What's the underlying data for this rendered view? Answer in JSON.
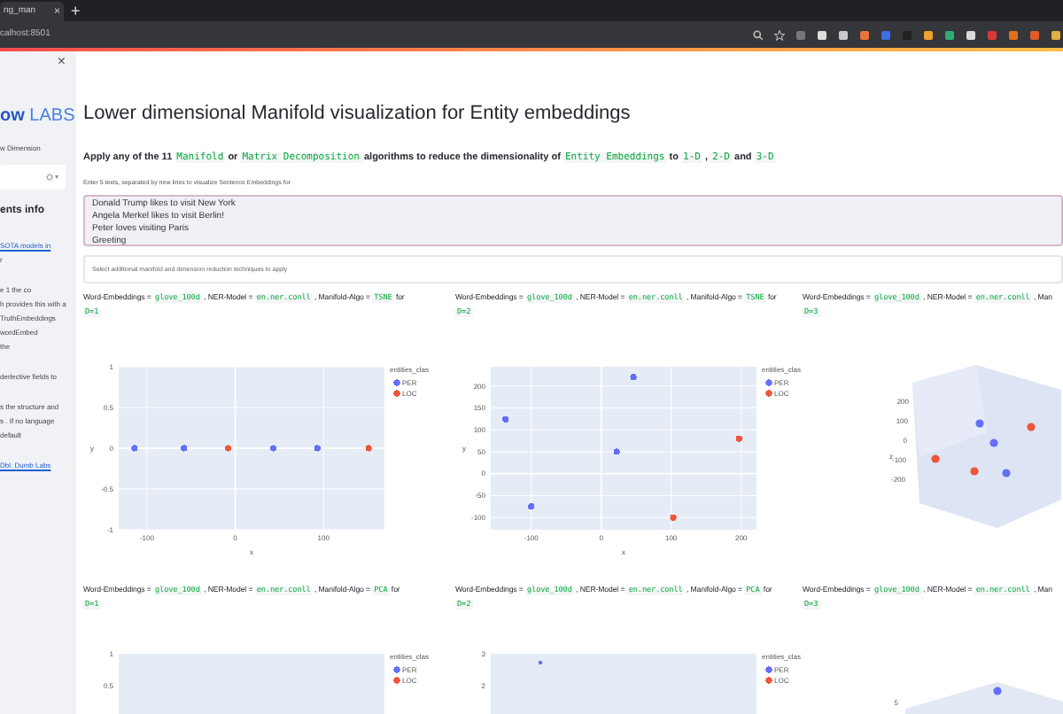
{
  "browser": {
    "tab": {
      "title": "ng_man",
      "close": "×"
    },
    "new_tab": "+",
    "address": "calhost:8501"
  },
  "sidebar": {
    "close": "×",
    "logo": {
      "part_1": "ow",
      "part_2": "LABS"
    },
    "subtitle": "w Dimension",
    "select": {
      "caret": "▾"
    },
    "heading": "ents info",
    "groups": [
      [
        {
          "kind": "link",
          "text": "SOTA models in"
        },
        {
          "kind": "text",
          "text": "r"
        }
      ],
      [
        {
          "kind": "text",
          "text": "e 1 the co"
        },
        {
          "kind": "text",
          "text": "h provides this with a"
        },
        {
          "kind": "text",
          "text": "TruthEmbeddings"
        },
        {
          "kind": "text",
          "text": "wordEmbed"
        },
        {
          "kind": "text",
          "text": "the"
        }
      ],
      [
        {
          "kind": "text",
          "text": "derlective fields to"
        }
      ],
      [
        {
          "kind": "text",
          "text": "s the structure and"
        },
        {
          "kind": "text",
          "text": "s . If no language"
        },
        {
          "kind": "text",
          "text": "default"
        }
      ],
      [
        {
          "kind": "link",
          "text": "Dbl. Dumb Labs"
        }
      ]
    ]
  },
  "main": {
    "title": "Lower dimensional Manifold visualization for Entity embeddings",
    "intro": [
      {
        "kind": "text",
        "text": "Apply any of the 11"
      },
      {
        "kind": "code",
        "text": "Manifold"
      },
      {
        "kind": "text",
        "text": "or"
      },
      {
        "kind": "code",
        "text": "Matrix Decomposition"
      },
      {
        "kind": "text",
        "text": "algorithms to reduce the dimensionality of"
      },
      {
        "kind": "code",
        "text": "Entity Embeddings"
      },
      {
        "kind": "text",
        "text": "to"
      },
      {
        "kind": "code",
        "text": "1-D"
      },
      {
        "kind": "text",
        "text": ","
      },
      {
        "kind": "code",
        "text": "2-D"
      },
      {
        "kind": "text",
        "text": "and"
      },
      {
        "kind": "code",
        "text": "3-D"
      }
    ],
    "textarea": {
      "label": "Enter 5 texts, separated by new lines to visualize Sentence Embeddings for",
      "value": "Donald Trump likes to visit New York\nAngela Merkel likes to visit Berlin!\nPeter loves visiting Paris\nGreeting"
    },
    "multiselect": {
      "placeholder": "Select additional manifold and dimension reduction techniques to apply"
    },
    "plots": [
      {
        "kind": "scatter2d",
        "caption": [
          [
            {
              "kind": "text",
              "text": "Word-Embeddings ="
            },
            {
              "kind": "code",
              "text": "glove_100d"
            },
            {
              "kind": "text",
              "text": ", NER-Model ="
            },
            {
              "kind": "code",
              "text": "en.ner.conll"
            },
            {
              "kind": "text",
              "text": ", Manifold-Algo ="
            },
            {
              "kind": "code",
              "text": "TSNE"
            },
            {
              "kind": "text",
              "text": "for"
            }
          ],
          [
            {
              "kind": "code",
              "text": "D=1"
            }
          ]
        ],
        "legend_title": "entities_clas",
        "chart_data": {
          "type": "scatter",
          "grid": true,
          "legend": "right",
          "xlabel": "x",
          "ylabel": "y",
          "xlim": [
            -132,
            169
          ],
          "ylim": [
            -1,
            1
          ],
          "xticks": [
            -100,
            0,
            100
          ],
          "yticks": [
            -1,
            -0.5,
            0,
            0.5,
            1
          ],
          "series": [
            {
              "name": "PER",
              "color": "#636efa",
              "x": [
                -114,
                -58,
                43,
                93
              ],
              "values": [
                0,
                0,
                0,
                0
              ]
            },
            {
              "name": "LOC",
              "color": "#ef553b",
              "x": [
                -8,
                151
              ],
              "values": [
                0,
                0
              ]
            }
          ]
        }
      },
      {
        "kind": "scatter2d",
        "caption": [
          [
            {
              "kind": "text",
              "text": "Word-Embeddings ="
            },
            {
              "kind": "code",
              "text": "glove_100d"
            },
            {
              "kind": "text",
              "text": ", NER-Model ="
            },
            {
              "kind": "code",
              "text": "en.ner.conll"
            },
            {
              "kind": "text",
              "text": ", Manifold-Algo ="
            },
            {
              "kind": "code",
              "text": "TSNE"
            },
            {
              "kind": "text",
              "text": "for"
            }
          ],
          [
            {
              "kind": "code",
              "text": "D=2"
            }
          ]
        ],
        "legend_title": "entities_clas",
        "chart_data": {
          "type": "scatter",
          "grid": true,
          "legend": "right",
          "xlabel": "x",
          "ylabel": "y",
          "xlim": [
            -158,
            222
          ],
          "ylim": [
            -128,
            244
          ],
          "xticks": [
            -100,
            0,
            100,
            200
          ],
          "yticks": [
            -100,
            -50,
            0,
            50,
            100,
            150,
            200
          ],
          "series": [
            {
              "name": "PER",
              "color": "#636efa",
              "x": [
                46,
                -137,
                22,
                -100
              ],
              "values": [
                220,
                124,
                50,
                -75
              ]
            },
            {
              "name": "LOC",
              "color": "#ef553b",
              "x": [
                197,
                103
              ],
              "values": [
                80,
                -100
              ]
            }
          ]
        }
      },
      {
        "kind": "scatter3d",
        "caption": [
          [
            {
              "kind": "text",
              "text": "Word-Embeddings ="
            },
            {
              "kind": "code",
              "text": "glove_100d"
            },
            {
              "kind": "text",
              "text": ", NER-Model ="
            },
            {
              "kind": "code",
              "text": "en.ner.conll"
            },
            {
              "kind": "text",
              "text": ", Man"
            }
          ],
          [
            {
              "kind": "code",
              "text": "D=3"
            }
          ]
        ],
        "axis_label": "z",
        "z_ticks": [
          "200",
          "100",
          "0",
          "-100",
          "-200"
        ]
      },
      {
        "kind": "partial2d",
        "caption": [
          [
            {
              "kind": "text",
              "text": "Word-Embeddings ="
            },
            {
              "kind": "code",
              "text": "glove_100d"
            },
            {
              "kind": "text",
              "text": ", NER-Model ="
            },
            {
              "kind": "code",
              "text": "en.ner.conll"
            },
            {
              "kind": "text",
              "text": ", Manifold-Algo ="
            },
            {
              "kind": "code",
              "text": "PCA"
            },
            {
              "kind": "text",
              "text": "for"
            }
          ],
          [
            {
              "kind": "code",
              "text": "D=1"
            }
          ]
        ],
        "legend_title": "entities_clas",
        "legend": [
          {
            "name": "PER",
            "color": "#636efa"
          },
          {
            "name": "LOC",
            "color": "#ef553b"
          }
        ],
        "y_ticks": [
          "1",
          "0.5"
        ]
      },
      {
        "kind": "partial2d",
        "caption": [
          [
            {
              "kind": "text",
              "text": "Word-Embeddings ="
            },
            {
              "kind": "code",
              "text": "glove_100d"
            },
            {
              "kind": "text",
              "text": ", NER-Model ="
            },
            {
              "kind": "code",
              "text": "en.ner.conll"
            },
            {
              "kind": "text",
              "text": ", Manifold-Algo ="
            },
            {
              "kind": "code",
              "text": "PCA"
            },
            {
              "kind": "text",
              "text": "for"
            }
          ],
          [
            {
              "kind": "code",
              "text": "D=2"
            }
          ]
        ],
        "legend_title": "entities_clas",
        "legend": [
          {
            "name": "PER",
            "color": "#636efa"
          },
          {
            "name": "LOC",
            "color": "#ef553b"
          }
        ],
        "y_ticks": [
          "3",
          "2"
        ]
      },
      {
        "kind": "partial3d",
        "caption": [
          [
            {
              "kind": "text",
              "text": "Word-Embeddings ="
            },
            {
              "kind": "code",
              "text": "glove_100d"
            },
            {
              "kind": "text",
              "text": ", NER-Model ="
            },
            {
              "kind": "code",
              "text": "en.ner.conll"
            },
            {
              "kind": "text",
              "text": ", Man"
            }
          ],
          [
            {
              "kind": "code",
              "text": "D=3"
            }
          ]
        ],
        "z_ticks": [
          "5"
        ]
      }
    ]
  }
}
